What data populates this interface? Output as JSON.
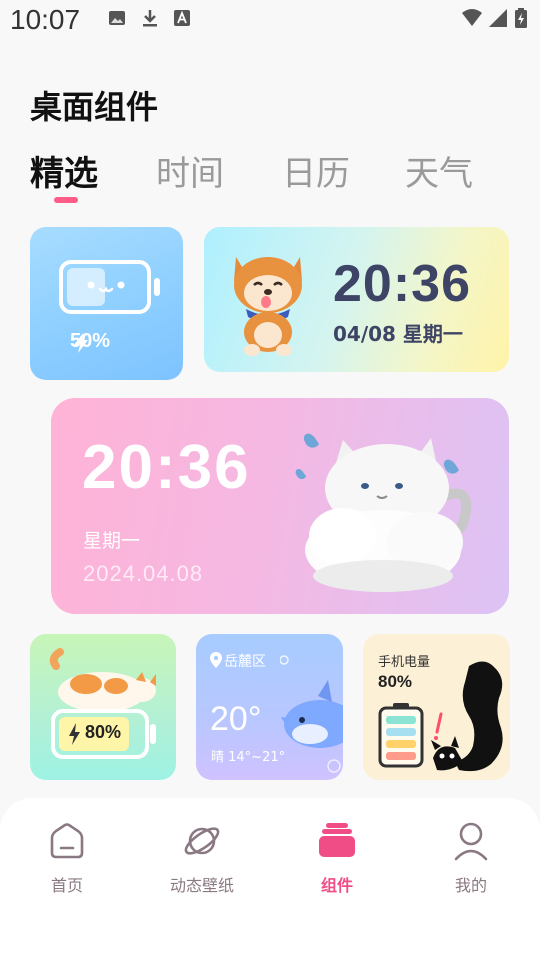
{
  "status_bar": {
    "time": "10:07",
    "icons": [
      "image-icon",
      "download-icon",
      "text-a-icon"
    ],
    "right_icons": [
      "wifi-icon",
      "cellular-icon",
      "battery-charging-icon"
    ]
  },
  "page_title": "桌面组件",
  "tabs": [
    {
      "label": "精选",
      "active": true
    },
    {
      "label": "时间",
      "active": false
    },
    {
      "label": "日历",
      "active": false
    },
    {
      "label": "天气",
      "active": false
    }
  ],
  "widgets": {
    "battery": {
      "percent_text": "50%",
      "level": 0.5
    },
    "dog_clock": {
      "time": "20:36",
      "date": "04/08  星期一"
    },
    "cat_clock": {
      "time": "20:36",
      "weekday": "星期一",
      "date": "2024.04.08"
    },
    "sleep_cat_battery": {
      "percent_text": "80%",
      "level": 0.8
    },
    "weather": {
      "location": "岳麓区",
      "temperature": "20°",
      "detail": "晴  14°~21°"
    },
    "phone_battery": {
      "label": "手机电量",
      "percent_text": "80%"
    }
  },
  "bottom_nav": [
    {
      "label": "首页",
      "icon": "home-icon",
      "active": false
    },
    {
      "label": "动态壁纸",
      "icon": "planet-icon",
      "active": false
    },
    {
      "label": "组件",
      "icon": "widgets-icon",
      "active": true
    },
    {
      "label": "我的",
      "icon": "profile-icon",
      "active": false
    }
  ],
  "colors": {
    "accent": "#f04d86",
    "tab_indicator": "#ff5c8a",
    "nav_inactive": "#8a7882"
  }
}
